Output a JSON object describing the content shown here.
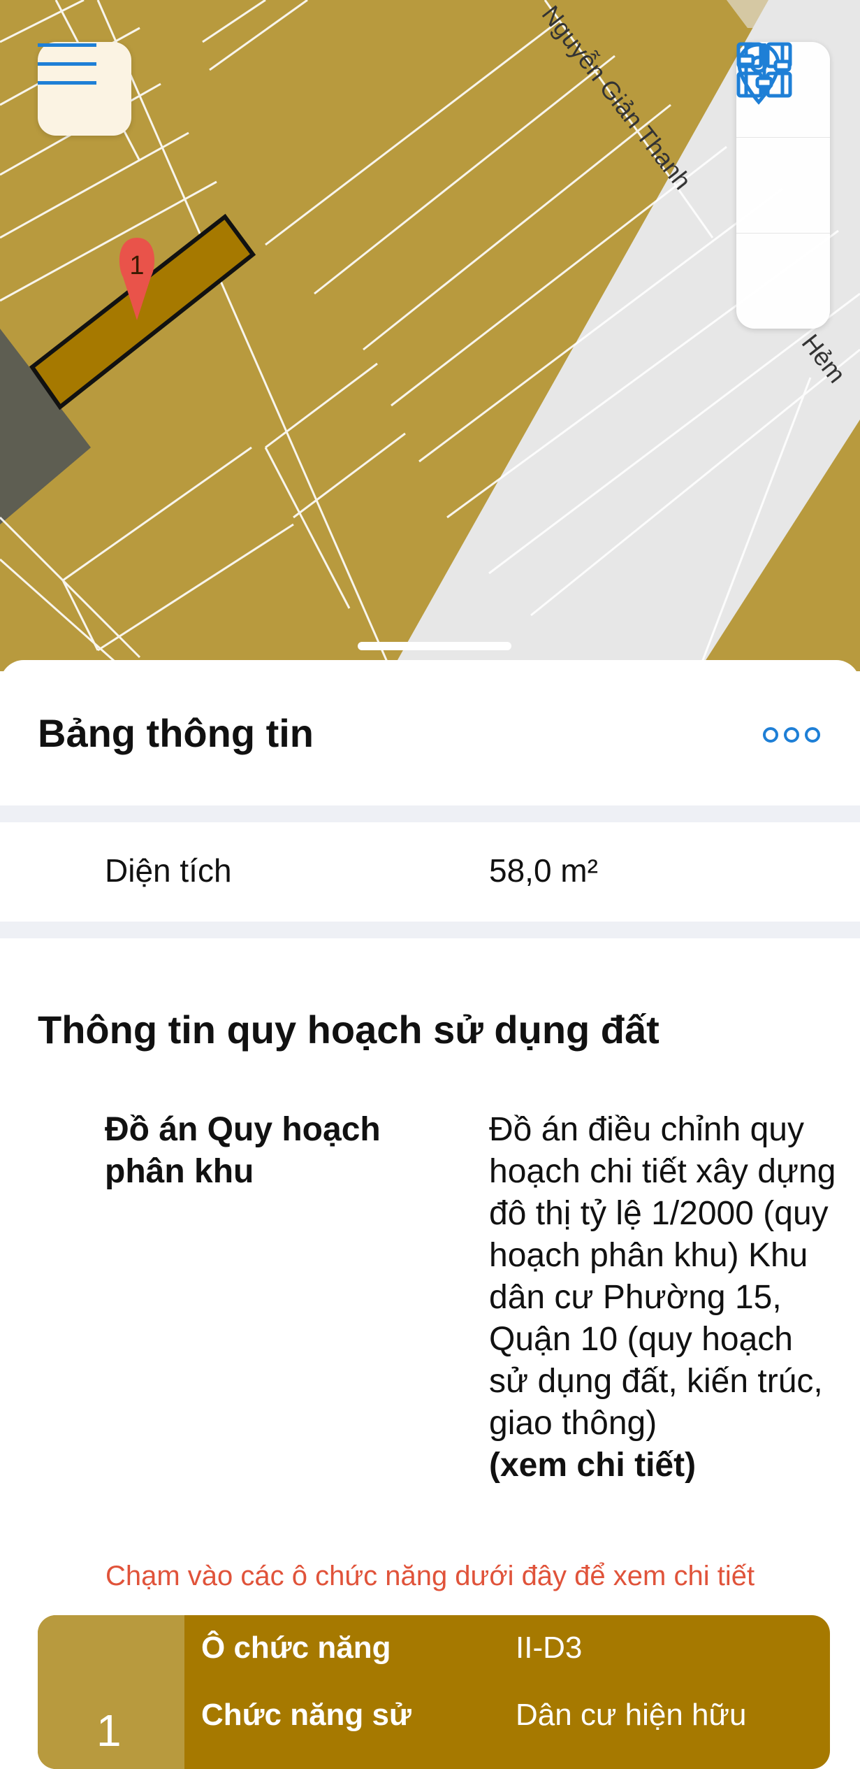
{
  "map": {
    "streets": [
      "Nguyễn Giản Thanh",
      "Hẻm"
    ],
    "marker_label": "1",
    "colors": {
      "land": "#b89a3e",
      "selected_lot": "#a67900",
      "road": "#e7e7e7",
      "marker": "#e9534a"
    }
  },
  "toolbar": {
    "icons": [
      "menu-icon",
      "grid-icon",
      "location-pin-icon",
      "sliders-icon"
    ]
  },
  "sheet": {
    "title": "Bảng thông tin",
    "area": {
      "label": "Diện tích",
      "value": "58,0 m²"
    },
    "planning": {
      "title": "Thông tin quy hoạch sử dụng đất",
      "label": "Đồ án Quy hoạch phân khu",
      "value": "Đồ án điều chỉnh quy hoạch chi tiết xây dựng đô thị tỷ lệ 1/2000 (quy hoạch phân khu) Khu dân cư Phường 15, Quận 10 (quy hoạch sử dụng đất, kiến trúc, giao thông)",
      "link": "(xem chi tiết)"
    },
    "hint": "Chạm vào các ô chức năng dưới đây để xem chi tiết",
    "card": {
      "number": "1",
      "rows": [
        {
          "key": "Ô chức năng",
          "value": "II-D3"
        },
        {
          "key": "Chức năng sử",
          "value": "Dân cư hiện hữu"
        }
      ]
    }
  }
}
